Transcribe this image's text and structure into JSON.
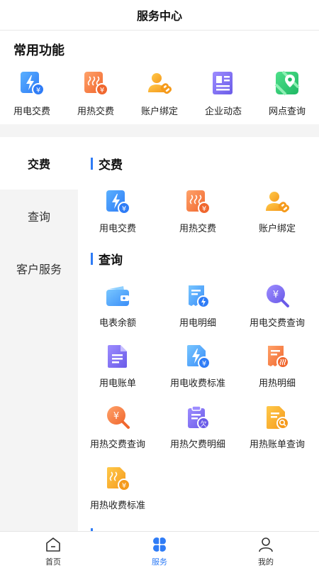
{
  "header": {
    "title": "服务中心"
  },
  "common": {
    "title": "常用功能",
    "items": [
      {
        "label": "用电交费",
        "icon": "electric-pay-icon"
      },
      {
        "label": "用热交费",
        "icon": "heat-pay-icon"
      },
      {
        "label": "账户绑定",
        "icon": "account-bind-icon"
      },
      {
        "label": "企业动态",
        "icon": "company-news-icon"
      },
      {
        "label": "网点查询",
        "icon": "map-location-icon"
      }
    ]
  },
  "sidenav": {
    "items": [
      {
        "label": "交费",
        "active": true
      },
      {
        "label": "查询",
        "active": false
      },
      {
        "label": "客户服务",
        "active": false
      }
    ]
  },
  "sections": {
    "pay": {
      "title": "交费",
      "items": [
        {
          "label": "用电交费",
          "icon": "electric-pay-icon"
        },
        {
          "label": "用热交费",
          "icon": "heat-pay-icon"
        },
        {
          "label": "账户绑定",
          "icon": "account-bind-icon"
        }
      ]
    },
    "query": {
      "title": "查询",
      "items": [
        {
          "label": "电表余额",
          "icon": "wallet-icon"
        },
        {
          "label": "用电明细",
          "icon": "electric-detail-icon"
        },
        {
          "label": "用电交费查询",
          "icon": "yuan-search-icon"
        },
        {
          "label": "用电账单",
          "icon": "document-icon"
        },
        {
          "label": "用电收费标准",
          "icon": "electric-standard-icon"
        },
        {
          "label": "用热明细",
          "icon": "heat-detail-icon"
        },
        {
          "label": "用热交费查询",
          "icon": "yuan-search-orange-icon"
        },
        {
          "label": "用热欠费明细",
          "icon": "arrears-clipboard-icon"
        },
        {
          "label": "用热账单查询",
          "icon": "bill-search-icon"
        },
        {
          "label": "用热收费标准",
          "icon": "heat-standard-icon"
        }
      ]
    }
  },
  "tabbar": {
    "items": [
      {
        "label": "首页",
        "icon": "home-icon",
        "active": false
      },
      {
        "label": "服务",
        "icon": "service-grid-icon",
        "active": true
      },
      {
        "label": "我的",
        "icon": "user-icon",
        "active": false
      }
    ]
  },
  "colors": {
    "accent": "#2f7cf6",
    "orange": "#f5843a",
    "yellow": "#f7a623",
    "purple": "#7b6cf0",
    "green": "#2bc66f"
  }
}
